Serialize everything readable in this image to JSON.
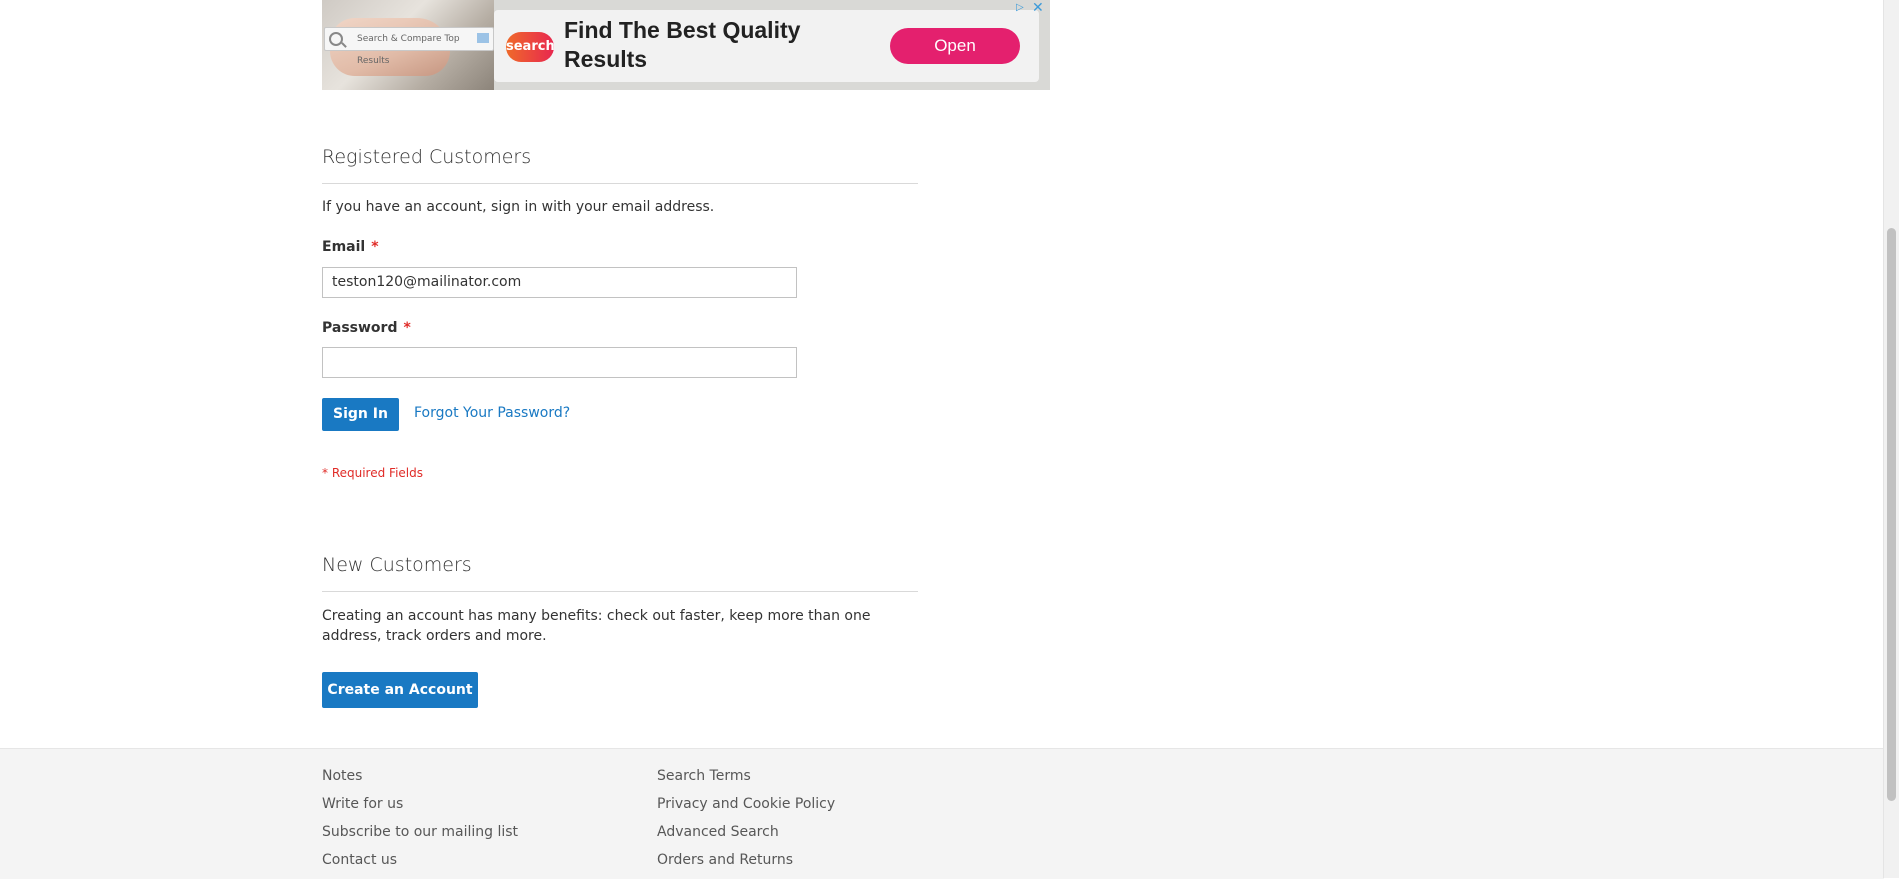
{
  "ad": {
    "search_bar_text": "Search & Compare Top Results",
    "logo_text": "search",
    "headline": "Find The Best Quality Results",
    "open_label": "Open",
    "choices_glyph": "▷",
    "close_glyph": "✕"
  },
  "login": {
    "title": "Registered Customers",
    "intro": "If you have an account, sign in with your email address.",
    "email_label": "Email",
    "email_value": "teston120@mailinator.com",
    "password_label": "Password",
    "password_value": "",
    "required_mark": "*",
    "sign_in_label": "Sign In",
    "forgot_label": "Forgot Your Password?",
    "required_note": "* Required Fields"
  },
  "register": {
    "title": "New Customers",
    "intro": "Creating an account has many benefits: check out faster, keep more than one address, track orders and more.",
    "create_label": "Create an Account"
  },
  "footer": {
    "col1": [
      "Notes",
      "Write for us",
      "Subscribe to our mailing list",
      "Contact us"
    ],
    "col2": [
      "Search Terms",
      "Privacy and Cookie Policy",
      "Advanced Search",
      "Orders and Returns"
    ]
  },
  "colors": {
    "primary": "#1979c3",
    "required": "#e02b27",
    "ad_button": "#e4206e"
  }
}
